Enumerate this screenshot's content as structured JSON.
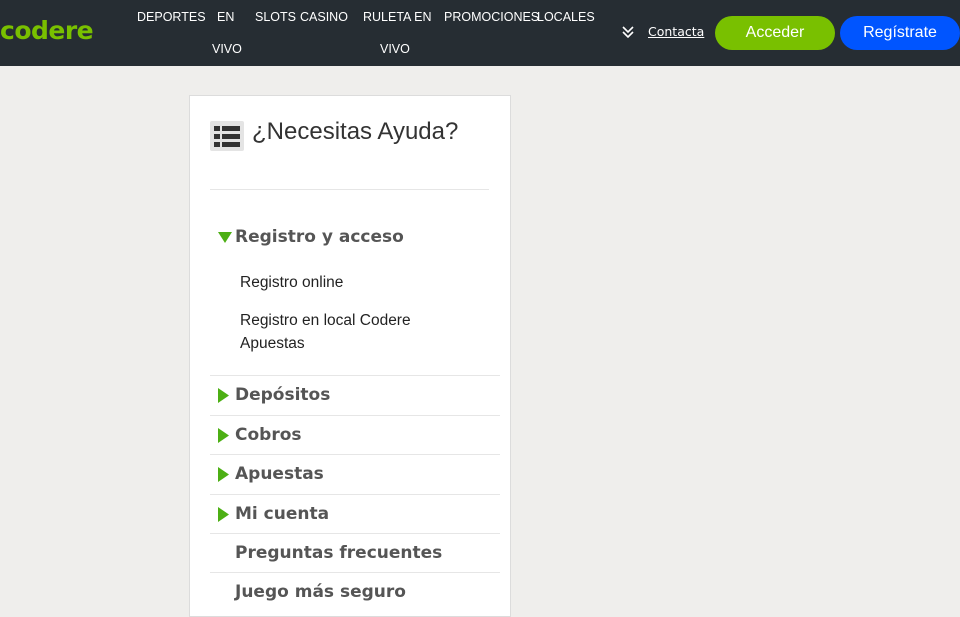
{
  "brand": {
    "logo_text": "codere",
    "logo_color": "#79c000"
  },
  "nav": {
    "deportes": "DEPORTES",
    "en": "EN",
    "vivo_1": "VIVO",
    "slots": "SLOTS",
    "casino": "CASINO",
    "ruleta_en": "RULETA EN",
    "vivo_2": "VIVO",
    "promociones": "PROMOCIONES",
    "locales": "LOCALES"
  },
  "header": {
    "more_icon": "double-chevron-down-icon",
    "contacta": "Contacta",
    "acceder": "Acceder",
    "registrate": "Regístrate"
  },
  "colors": {
    "header_bg": "#262d33",
    "accent_green": "#79c000",
    "accent_blue": "#0055ff",
    "page_bg": "#efeeec"
  },
  "help": {
    "title": "¿Necesitas Ayuda?",
    "title_icon": "list-icon",
    "sections": [
      {
        "label": "Registro y acceso",
        "expanded": true,
        "items": [
          "Registro online",
          "Registro en local Codere Apuestas"
        ]
      },
      {
        "label": "Depósitos",
        "expanded": false
      },
      {
        "label": "Cobros",
        "expanded": false
      },
      {
        "label": "Apuestas",
        "expanded": false
      },
      {
        "label": "Mi cuenta",
        "expanded": false
      },
      {
        "label": "Preguntas frecuentes"
      },
      {
        "label": "Juego más seguro"
      }
    ]
  }
}
